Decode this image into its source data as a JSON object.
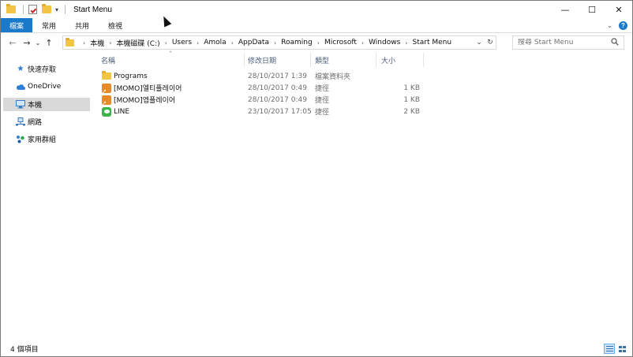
{
  "window": {
    "title": "Start Menu",
    "controls": {
      "minimize": "—",
      "maximize": "☐",
      "close": "✕"
    }
  },
  "quick_access": {
    "dropdown": "▾"
  },
  "ribbon": {
    "tabs": [
      {
        "label": "檔案",
        "active": true
      },
      {
        "label": "常用"
      },
      {
        "label": "共用"
      },
      {
        "label": "檢視"
      }
    ],
    "expand": "⌄",
    "help": "?"
  },
  "navigation": {
    "back": "←",
    "forward": "→",
    "recent": "⌄",
    "up": "↑"
  },
  "address_bar": {
    "breadcrumbs": [
      "本機",
      "本機磁碟 (C:)",
      "Users",
      "Amola",
      "AppData",
      "Roaming",
      "Microsoft",
      "Windows",
      "Start Menu"
    ],
    "separator": "›",
    "dropdown": "⌄",
    "refresh": "↻"
  },
  "search": {
    "placeholder": "搜尋 Start Menu"
  },
  "nav_pane": {
    "items": [
      {
        "label": "快速存取",
        "icon": "star-icon"
      },
      {
        "label": "OneDrive",
        "icon": "cloud-icon"
      },
      {
        "label": "本機",
        "icon": "computer-icon",
        "selected": true
      },
      {
        "label": "網路",
        "icon": "network-icon"
      },
      {
        "label": "家用群組",
        "icon": "homegroup-icon"
      }
    ]
  },
  "file_list": {
    "sort_indicator": "˄",
    "columns": {
      "name": "名稱",
      "date": "修改日期",
      "type": "類型",
      "size": "大小"
    },
    "rows": [
      {
        "name": "Programs",
        "date": "28/10/2017 1:39",
        "type": "檔案資料夾",
        "size": "",
        "icon": "folder-icon"
      },
      {
        "name": "[MOMO]엘티플레이어",
        "date": "28/10/2017 0:49",
        "type": "捷徑",
        "size": "1 KB",
        "icon": "shortcut-icon"
      },
      {
        "name": "[MOMO]엡플레이어",
        "date": "28/10/2017 0:49",
        "type": "捷徑",
        "size": "1 KB",
        "icon": "shortcut-icon"
      },
      {
        "name": "LINE",
        "date": "23/10/2017 17:05",
        "type": "捷徑",
        "size": "2 KB",
        "icon": "line-app-icon"
      }
    ]
  },
  "status_bar": {
    "item_count": "4 個項目"
  }
}
